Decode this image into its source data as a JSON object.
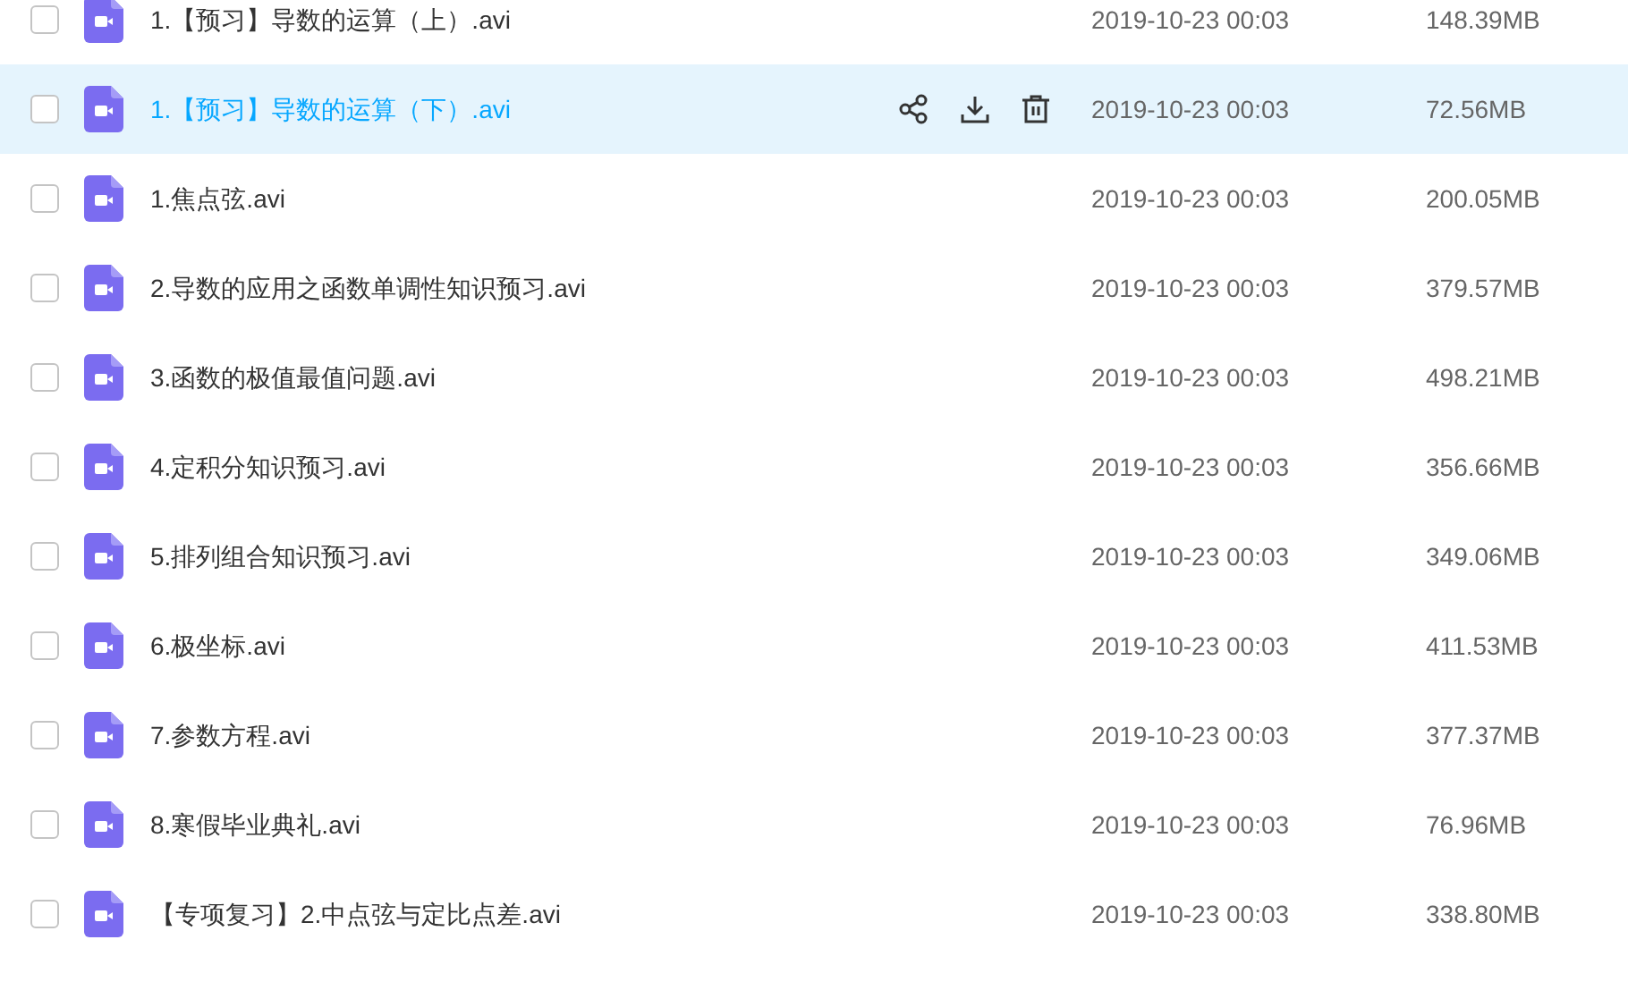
{
  "files": [
    {
      "name": "1.【预习】导数的运算（上）.avi",
      "modified": "2019-10-23 00:03",
      "size": "148.39MB",
      "checked": false,
      "highlighted": false
    },
    {
      "name": "1.【预习】导数的运算（下）.avi",
      "modified": "2019-10-23 00:03",
      "size": "72.56MB",
      "checked": false,
      "highlighted": true
    },
    {
      "name": "1.焦点弦.avi",
      "modified": "2019-10-23 00:03",
      "size": "200.05MB",
      "checked": false,
      "highlighted": false
    },
    {
      "name": "2.导数的应用之函数单调性知识预习.avi",
      "modified": "2019-10-23 00:03",
      "size": "379.57MB",
      "checked": false,
      "highlighted": false
    },
    {
      "name": "3.函数的极值最值问题.avi",
      "modified": "2019-10-23 00:03",
      "size": "498.21MB",
      "checked": false,
      "highlighted": false
    },
    {
      "name": "4.定积分知识预习.avi",
      "modified": "2019-10-23 00:03",
      "size": "356.66MB",
      "checked": false,
      "highlighted": false
    },
    {
      "name": "5.排列组合知识预习.avi",
      "modified": "2019-10-23 00:03",
      "size": "349.06MB",
      "checked": false,
      "highlighted": false
    },
    {
      "name": "6.极坐标.avi",
      "modified": "2019-10-23 00:03",
      "size": "411.53MB",
      "checked": false,
      "highlighted": false
    },
    {
      "name": "7.参数方程.avi",
      "modified": "2019-10-23 00:03",
      "size": "377.37MB",
      "checked": false,
      "highlighted": false
    },
    {
      "name": "8.寒假毕业典礼.avi",
      "modified": "2019-10-23 00:03",
      "size": "76.96MB",
      "checked": false,
      "highlighted": false
    },
    {
      "name": "【专项复习】2.中点弦与定比点差.avi",
      "modified": "2019-10-23 00:03",
      "size": "338.80MB",
      "checked": false,
      "highlighted": false
    }
  ]
}
